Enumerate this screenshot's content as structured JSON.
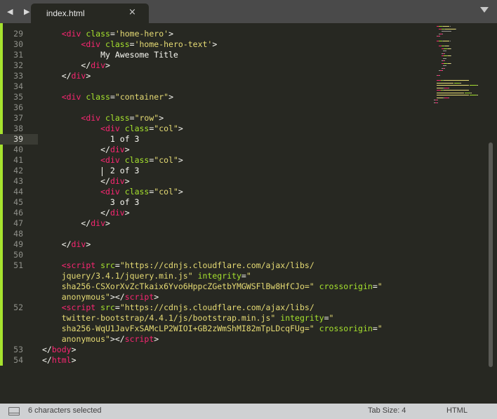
{
  "tab": {
    "label": "index.html",
    "close": "×",
    "nav": "◀ ▶"
  },
  "gutter": {
    "lines": [
      "29",
      "30",
      "31",
      "32",
      "33",
      "34",
      "35",
      "36",
      "37",
      "38",
      "39",
      "40",
      "41",
      "42",
      "43",
      "44",
      "45",
      "46",
      "47",
      "48",
      "49",
      "50",
      "51",
      "",
      "",
      "",
      "52",
      "",
      "",
      "",
      "53",
      "54"
    ],
    "active_line": "39"
  },
  "code": [
    [
      [
        "p",
        "    "
      ],
      [
        "t",
        "<div "
      ],
      [
        "a",
        "class"
      ],
      [
        "p",
        "="
      ],
      [
        "s",
        "'home-hero'"
      ],
      [
        "p",
        ">"
      ]
    ],
    [
      [
        "p",
        "        "
      ],
      [
        "t",
        "<div "
      ],
      [
        "a",
        "class"
      ],
      [
        "p",
        "="
      ],
      [
        "s",
        "'home-hero-text'"
      ],
      [
        "p",
        ">"
      ]
    ],
    [
      [
        "p",
        "            My Awesome Title"
      ]
    ],
    [
      [
        "p",
        "        </"
      ],
      [
        "t",
        "div"
      ],
      [
        "p",
        ">"
      ]
    ],
    [
      [
        "p",
        "    </"
      ],
      [
        "t",
        "div"
      ],
      [
        "p",
        ">"
      ]
    ],
    [
      [
        "p",
        ""
      ]
    ],
    [
      [
        "p",
        "    "
      ],
      [
        "t",
        "<div "
      ],
      [
        "a",
        "class"
      ],
      [
        "p",
        "="
      ],
      [
        "s",
        "\"container\""
      ],
      [
        "p",
        ">"
      ]
    ],
    [
      [
        "p",
        ""
      ]
    ],
    [
      [
        "p",
        "        "
      ],
      [
        "t",
        "<div "
      ],
      [
        "a",
        "class"
      ],
      [
        "p",
        "="
      ],
      [
        "s",
        "\"row\""
      ],
      [
        "p",
        ">"
      ]
    ],
    [
      [
        "p",
        "            "
      ],
      [
        "t",
        "<div "
      ],
      [
        "a",
        "class"
      ],
      [
        "p",
        "="
      ],
      [
        "s",
        "\"col\""
      ],
      [
        "p",
        ">"
      ]
    ],
    [
      [
        "p",
        "              1 of 3"
      ]
    ],
    [
      [
        "p",
        "            </"
      ],
      [
        "t",
        "div"
      ],
      [
        "p",
        ">"
      ]
    ],
    [
      [
        "p",
        "            "
      ],
      [
        "t",
        "<div "
      ],
      [
        "a",
        "class"
      ],
      [
        "p",
        "="
      ],
      [
        "s",
        "\"col\""
      ],
      [
        "p",
        ">"
      ]
    ],
    [
      [
        "p",
        "              2 of 3"
      ]
    ],
    [
      [
        "p",
        "            </"
      ],
      [
        "t",
        "div"
      ],
      [
        "p",
        ">"
      ]
    ],
    [
      [
        "p",
        "            "
      ],
      [
        "t",
        "<div "
      ],
      [
        "a",
        "class"
      ],
      [
        "p",
        "="
      ],
      [
        "s",
        "\"col\""
      ],
      [
        "p",
        ">"
      ]
    ],
    [
      [
        "p",
        "              3 of 3"
      ]
    ],
    [
      [
        "p",
        "            </"
      ],
      [
        "t",
        "div"
      ],
      [
        "p",
        ">"
      ]
    ],
    [
      [
        "p",
        "        </"
      ],
      [
        "t",
        "div"
      ],
      [
        "p",
        ">"
      ]
    ],
    [
      [
        "p",
        ""
      ]
    ],
    [
      [
        "p",
        "    </"
      ],
      [
        "t",
        "div"
      ],
      [
        "p",
        ">"
      ]
    ],
    [
      [
        "p",
        ""
      ]
    ],
    [
      [
        "p",
        "    "
      ],
      [
        "t",
        "<script "
      ],
      [
        "a",
        "src"
      ],
      [
        "p",
        "="
      ],
      [
        "s",
        "\"https://cdnjs.cloudflare.com/ajax/libs/"
      ]
    ],
    [
      [
        "s",
        "    jquery/3.4.1/jquery.min.js\""
      ],
      [
        "p",
        " "
      ],
      [
        "a",
        "integrity"
      ],
      [
        "p",
        "="
      ],
      [
        "s",
        "\""
      ]
    ],
    [
      [
        "s",
        "    sha256-CSXorXvZcTkaix6Yvo6HppcZGetbYMGWSFlBw8HfCJo=\""
      ],
      [
        "p",
        " "
      ],
      [
        "a",
        "crossorigin"
      ],
      [
        "p",
        "="
      ],
      [
        "s",
        "\""
      ]
    ],
    [
      [
        "s",
        "    anonymous\""
      ],
      [
        "p",
        "></"
      ],
      [
        "t",
        "script"
      ],
      [
        "p",
        ">"
      ]
    ],
    [
      [
        "p",
        "    "
      ],
      [
        "t",
        "<script "
      ],
      [
        "a",
        "src"
      ],
      [
        "p",
        "="
      ],
      [
        "s",
        "\"https://cdnjs.cloudflare.com/ajax/libs/"
      ]
    ],
    [
      [
        "s",
        "    twitter-bootstrap/4.4.1/js/bootstrap.min.js\""
      ],
      [
        "p",
        " "
      ],
      [
        "a",
        "integrity"
      ],
      [
        "p",
        "="
      ],
      [
        "s",
        "\""
      ]
    ],
    [
      [
        "s",
        "    sha256-WqU1JavFxSAMcLP2WIOI+GB2zWmShMI82mTpLDcqFUg=\""
      ],
      [
        "p",
        " "
      ],
      [
        "a",
        "crossorigin"
      ],
      [
        "p",
        "="
      ],
      [
        "s",
        "\""
      ]
    ],
    [
      [
        "s",
        "    anonymous\""
      ],
      [
        "p",
        "></"
      ],
      [
        "t",
        "script"
      ],
      [
        "p",
        ">"
      ]
    ],
    [
      [
        "p",
        "</"
      ],
      [
        "t",
        "body"
      ],
      [
        "p",
        ">"
      ]
    ],
    [
      [
        "p",
        "</"
      ],
      [
        "t",
        "html"
      ],
      [
        "p",
        ">"
      ]
    ]
  ],
  "status": {
    "selection": "6 characters selected",
    "tab_size": "Tab Size: 4",
    "syntax": "HTML"
  },
  "colors": {
    "background": "#272822",
    "tag": "#f92672",
    "attribute": "#a6e22e",
    "string": "#e6db74",
    "text": "#f8f8f2",
    "gutter_modified": "#a6e22e"
  }
}
